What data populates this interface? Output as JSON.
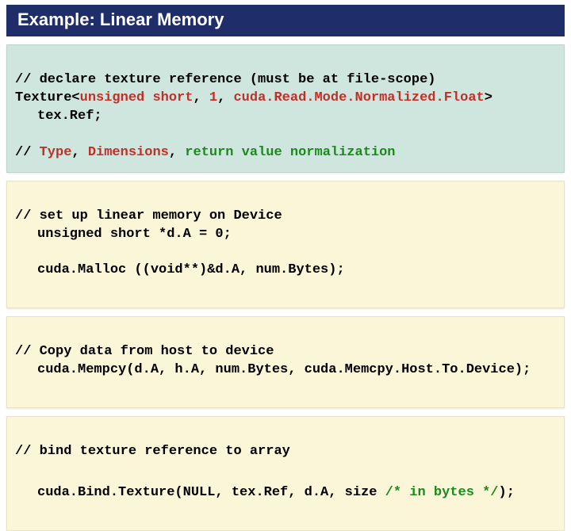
{
  "title": "Example: Linear Memory",
  "box1": {
    "l1": "// declare texture reference (must be at file-scope)",
    "l2a": "Texture<",
    "l2b": "unsigned short",
    "l2c": ", ",
    "l2d": "1",
    "l2e": ", ",
    "l2f": "cuda.Read.Mode.Normalized.Float",
    "l2g": ">",
    "l3": "tex.Ref;",
    "l4a": "// ",
    "l4b": "Type",
    "l4c": ", ",
    "l4d": "Dimensions",
    "l4e": ", ",
    "l4f": "return value normalization"
  },
  "box2": {
    "l1": "// set up linear memory on Device",
    "l2": "unsigned short *d.A = 0;",
    "l3": "cuda.Malloc ((void**)&d.A, num.Bytes);"
  },
  "box3": {
    "l1": "// Copy data from host to device",
    "l2": "cuda.Mempcy(d.A, h.A, num.Bytes, cuda.Memcpy.Host.To.Device);"
  },
  "box4": {
    "l1": "// bind texture reference to array",
    "l2a": "cuda.Bind.Texture(NULL, tex.Ref, d.A, size ",
    "l2b": "/* in bytes */",
    "l2c": ");"
  }
}
